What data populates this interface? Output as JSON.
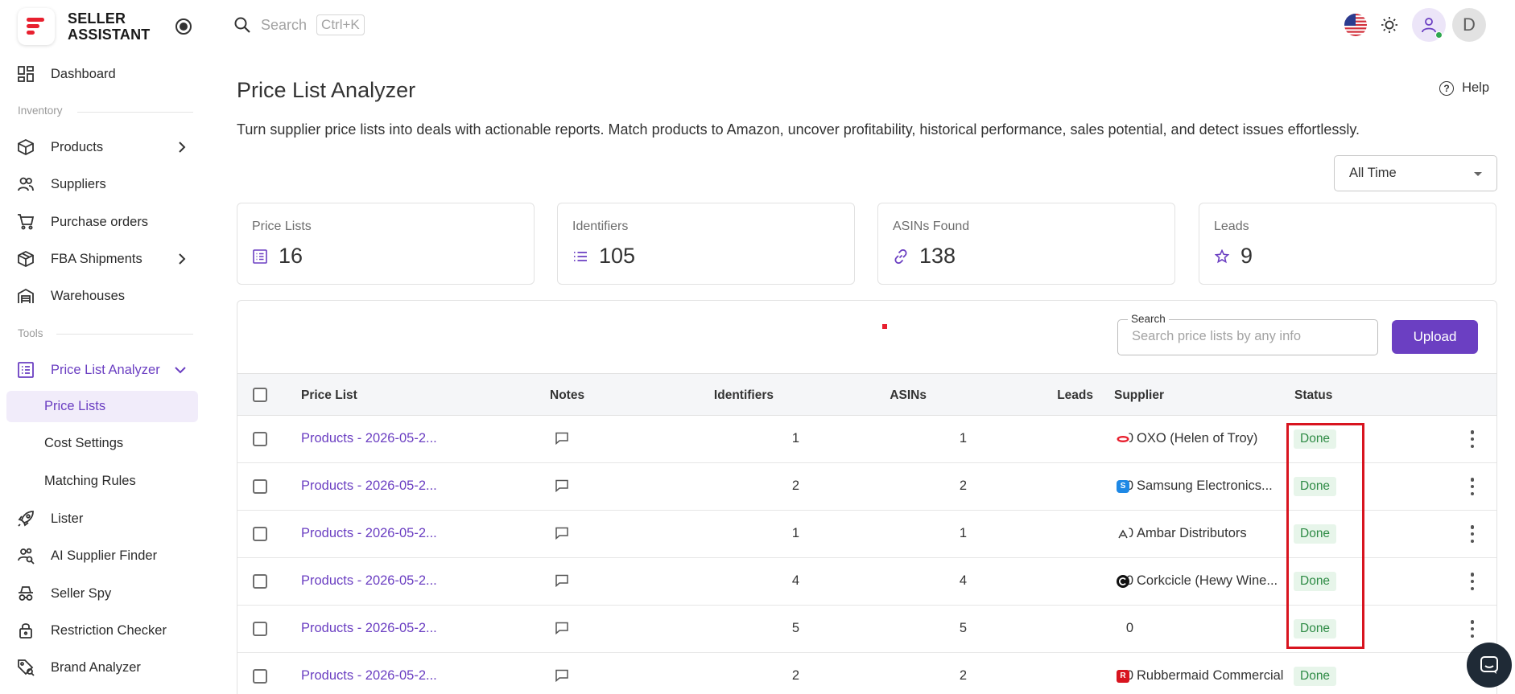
{
  "brand": {
    "line1": "SELLER",
    "line2": "ASSISTANT"
  },
  "search": {
    "placeholder": "Search",
    "shortcut": "Ctrl+K"
  },
  "sidebar": {
    "dashboard": "Dashboard",
    "section_inventory": "Inventory",
    "products": "Products",
    "suppliers": "Suppliers",
    "purchase_orders": "Purchase orders",
    "fba_shipments": "FBA Shipments",
    "warehouses": "Warehouses",
    "section_tools": "Tools",
    "price_list_analyzer": "Price List Analyzer",
    "price_lists": "Price Lists",
    "cost_settings": "Cost Settings",
    "matching_rules": "Matching Rules",
    "lister": "Lister",
    "ai_supplier_finder": "AI Supplier Finder",
    "seller_spy": "Seller Spy",
    "restriction_checker": "Restriction Checker",
    "brand_analyzer": "Brand Analyzer"
  },
  "user": {
    "initial": "D"
  },
  "page": {
    "title": "Price List Analyzer",
    "help": "Help",
    "subtitle": "Turn supplier price lists into deals with actionable reports. Match products to Amazon, uncover profitability, historical performance, sales potential, and detect issues effortlessly.",
    "range": "All Time"
  },
  "stats": {
    "price_lists": {
      "label": "Price Lists",
      "value": "16"
    },
    "identifiers": {
      "label": "Identifiers",
      "value": "105"
    },
    "asins": {
      "label": "ASINs Found",
      "value": "138"
    },
    "leads": {
      "label": "Leads",
      "value": "9"
    }
  },
  "table": {
    "search_label": "Search",
    "search_placeholder": "Search price lists by any info",
    "upload": "Upload",
    "headers": {
      "price_list": "Price List",
      "notes": "Notes",
      "identifiers": "Identifiers",
      "asins": "ASINs",
      "leads": "Leads",
      "supplier": "Supplier",
      "status": "Status"
    },
    "rows": [
      {
        "name": "Products - 2026-05-2...",
        "identifiers": "1",
        "asins": "1",
        "leads": "0",
        "supplier": "OXO (Helen of Troy)",
        "status": "Done"
      },
      {
        "name": "Products - 2026-05-2...",
        "identifiers": "2",
        "asins": "2",
        "leads": "0",
        "supplier": "Samsung Electronics...",
        "status": "Done"
      },
      {
        "name": "Products - 2026-05-2...",
        "identifiers": "1",
        "asins": "1",
        "leads": "0",
        "supplier": "Ambar Distributors",
        "status": "Done"
      },
      {
        "name": "Products - 2026-05-2...",
        "identifiers": "4",
        "asins": "4",
        "leads": "0",
        "supplier": "Corkcicle (Hewy Wine...",
        "status": "Done"
      },
      {
        "name": "Products - 2026-05-2...",
        "identifiers": "5",
        "asins": "5",
        "leads": "0",
        "supplier": "",
        "status": "Done"
      },
      {
        "name": "Products - 2026-05-2...",
        "identifiers": "2",
        "asins": "2",
        "leads": "0",
        "supplier": "Rubbermaid Commercial",
        "status": "Done"
      }
    ]
  },
  "colors": {
    "accent": "#6b3fc2",
    "brand_red": "#e8202f",
    "done_bg": "#e7f5ea",
    "done_text": "#2e8b45",
    "highlight": "#d8141f"
  }
}
